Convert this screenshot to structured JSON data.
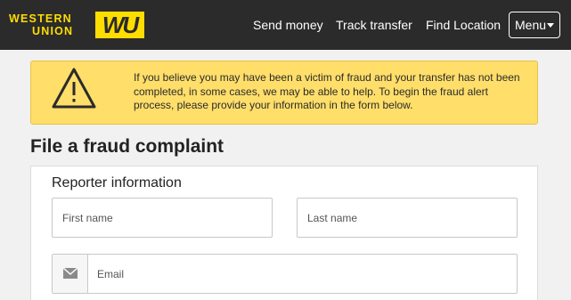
{
  "header": {
    "logo": {
      "line1": "WESTERN",
      "line2": "UNION",
      "mark": "WU"
    },
    "nav": {
      "send_money": "Send money",
      "track_transfer": "Track transfer",
      "find_location": "Find Location"
    },
    "menu_label": "Menu"
  },
  "alert": {
    "icon": "warning-triangle-icon",
    "message": "If you believe you may have been a victim of fraud and your transfer has not been completed, in some cases, we may be able to help. To begin the fraud alert process, please provide your information in the form below."
  },
  "page": {
    "title": "File a fraud complaint"
  },
  "form": {
    "section_title": "Reporter information",
    "first_name": {
      "placeholder": "First name",
      "value": ""
    },
    "last_name": {
      "placeholder": "Last name",
      "value": ""
    },
    "email": {
      "placeholder": "Email",
      "value": "",
      "icon": "envelope-icon"
    }
  },
  "colors": {
    "header_bg": "#2b2b2b",
    "brand_yellow": "#ffdd00",
    "alert_bg": "#ffde6a",
    "page_bg": "#f1f1f1"
  }
}
